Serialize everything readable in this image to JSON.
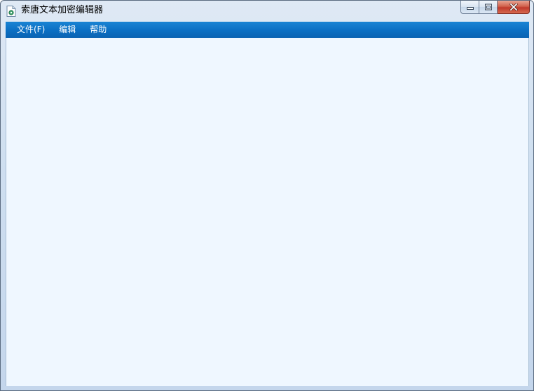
{
  "window": {
    "title": "索唐文本加密编辑器",
    "app_icon": "document-gear-icon",
    "caption_buttons": {
      "minimize_icon": "minimize-icon",
      "maximize_icon": "restore-icon",
      "close_icon": "close-icon"
    }
  },
  "menubar": {
    "items": [
      {
        "label": "文件(F)"
      },
      {
        "label": "编辑"
      },
      {
        "label": "帮助"
      }
    ]
  },
  "colors": {
    "menubar": "#0b6fc3",
    "content_background": "#eff7ff",
    "close_button": "#c0392b"
  }
}
